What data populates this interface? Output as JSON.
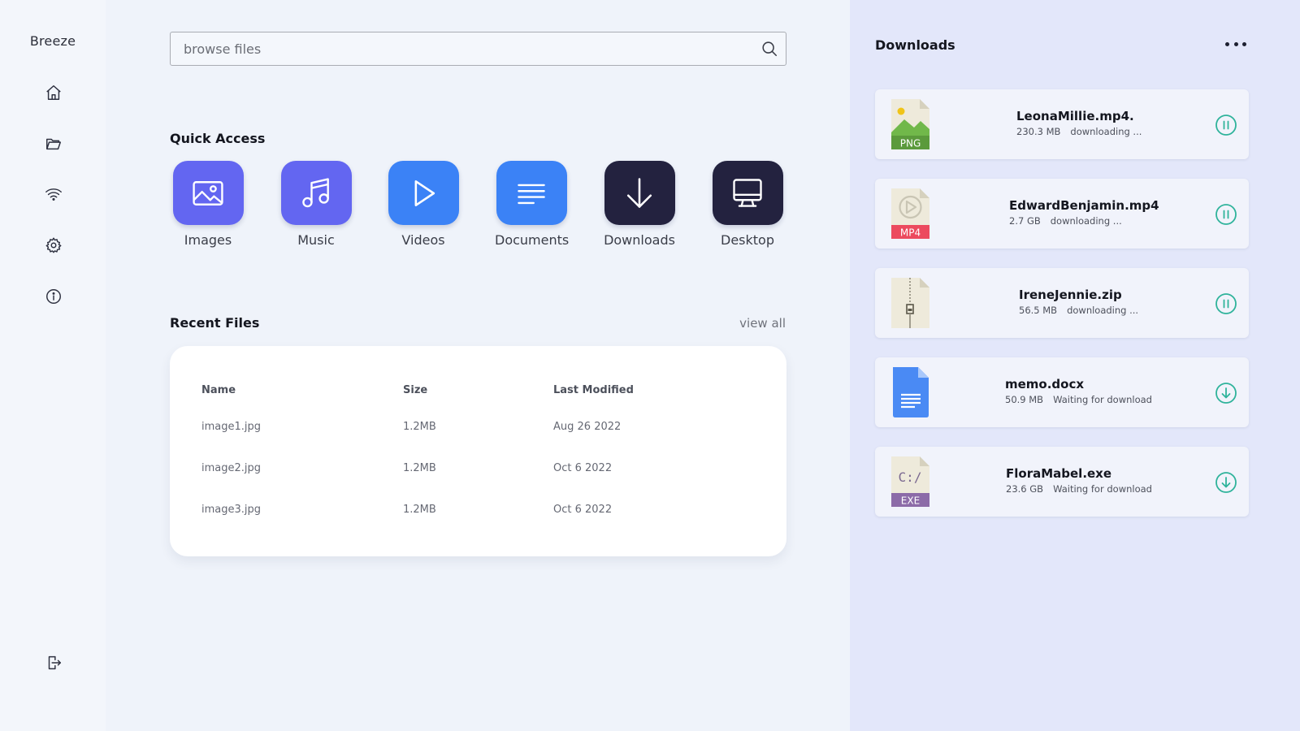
{
  "app": {
    "brand": "Breeze"
  },
  "sidebar": {
    "items": [
      {
        "icon": "home-icon"
      },
      {
        "icon": "folder-icon"
      },
      {
        "icon": "wifi-icon"
      },
      {
        "icon": "gear-icon"
      },
      {
        "icon": "info-icon"
      }
    ],
    "logout_icon": "logout-icon"
  },
  "search": {
    "placeholder": "browse files",
    "value": ""
  },
  "quick_access": {
    "title": "Quick Access",
    "items": [
      {
        "label": "Images",
        "icon": "image-icon",
        "color": "#6366f1"
      },
      {
        "label": "Music",
        "icon": "music-icon",
        "color": "#6366f1"
      },
      {
        "label": "Videos",
        "icon": "play-icon",
        "color": "#3b82f6"
      },
      {
        "label": "Documents",
        "icon": "lines-icon",
        "color": "#3b82f6"
      },
      {
        "label": "Downloads",
        "icon": "download-arrow-icon",
        "color": "#23223f"
      },
      {
        "label": "Desktop",
        "icon": "monitor-icon",
        "color": "#23223f"
      }
    ]
  },
  "recent_files": {
    "title": "Recent Files",
    "view_all": "view all",
    "columns": [
      "Name",
      "Size",
      "Last Modified"
    ],
    "rows": [
      {
        "name": "image1.jpg",
        "size": "1.2MB",
        "modified": "Aug 26 2022"
      },
      {
        "name": "image2.jpg",
        "size": "1.2MB",
        "modified": "Oct 6 2022"
      },
      {
        "name": "image3.jpg",
        "size": "1.2MB",
        "modified": "Oct 6 2022"
      }
    ]
  },
  "downloads": {
    "title": "Downloads",
    "items": [
      {
        "name": "LeonaMillie.mp4.",
        "size": "230.3 MB",
        "status": "downloading ...",
        "file_icon": "png-file-icon",
        "badge": "PNG",
        "badge_color": "#5b9a3c",
        "action": "pause"
      },
      {
        "name": "EdwardBenjamin.mp4",
        "size": "2.7 GB",
        "status": "downloading ...",
        "file_icon": "mp4-file-icon",
        "badge": "MP4",
        "badge_color": "#ec4a5e",
        "action": "pause"
      },
      {
        "name": "IreneJennie.zip",
        "size": "56.5 MB",
        "status": "downloading ...",
        "file_icon": "zip-file-icon",
        "badge": "",
        "badge_color": "",
        "action": "pause"
      },
      {
        "name": "memo.docx",
        "size": "50.9 MB",
        "status": "Waiting for download",
        "file_icon": "doc-file-icon",
        "badge": "",
        "badge_color": "#4a8af4",
        "action": "download"
      },
      {
        "name": "FloraMabel.exe",
        "size": "23.6 GB",
        "status": "Waiting for download",
        "file_icon": "exe-file-icon",
        "badge": "EXE",
        "badge_color": "#8c6ba8",
        "action": "download"
      }
    ]
  },
  "colors": {
    "accent_teal": "#2fb39b",
    "panel_bg": "#e3e7fa"
  }
}
